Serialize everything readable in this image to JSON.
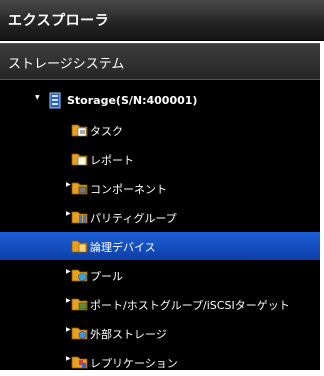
{
  "explorer": {
    "title": "エクスプローラ"
  },
  "section": {
    "label": "ストレージシステム"
  },
  "tree": {
    "root": {
      "label": "Storage(S/N:400001)",
      "icon": "storage-system-icon",
      "expanded": true
    },
    "items": [
      {
        "label": "タスク",
        "icon": "folder-icon",
        "has_children": false
      },
      {
        "label": "レポート",
        "icon": "folder-icon",
        "has_children": false
      },
      {
        "label": "コンポーネント",
        "icon": "folder-icon",
        "has_children": true
      },
      {
        "label": "パリティグループ",
        "icon": "folder-icon",
        "has_children": true
      },
      {
        "label": "論理デバイス",
        "icon": "folder-icon",
        "has_children": false,
        "selected": true
      },
      {
        "label": "プール",
        "icon": "folder-icon",
        "has_children": true
      },
      {
        "label": "ポート/ホストグループ/iSCSIターゲット",
        "icon": "folder-icon",
        "has_children": true
      },
      {
        "label": "外部ストレージ",
        "icon": "folder-icon",
        "has_children": true
      },
      {
        "label": "レプリケーション",
        "icon": "folder-icon",
        "has_children": true
      }
    ]
  },
  "colors": {
    "selection": "#1e5fd6",
    "folder": "#e8a020",
    "tree_background": "#000000"
  }
}
